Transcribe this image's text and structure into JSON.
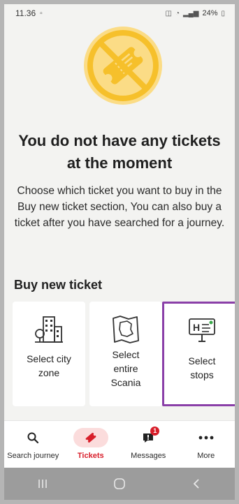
{
  "status_bar": {
    "time": "11.36",
    "battery": "24%"
  },
  "empty_state": {
    "title": "You do not have any tickets at the moment",
    "description": "Choose which ticket you want to buy in the Buy new ticket section, You can also buy a ticket after you have searched for a journey."
  },
  "buy_section": {
    "title": "Buy new ticket",
    "options": [
      {
        "label": "Select city zone",
        "icon": "city-buildings-icon"
      },
      {
        "label": "Select entire Scania",
        "icon": "scania-map-icon"
      },
      {
        "label": "Select stops",
        "icon": "bus-stop-sign-icon",
        "selected": true
      }
    ]
  },
  "bottom_nav": {
    "items": [
      {
        "label": "Search journey",
        "icon": "search-icon"
      },
      {
        "label": "Tickets",
        "icon": "ticket-icon",
        "active": true
      },
      {
        "label": "Messages",
        "icon": "message-icon",
        "badge": "1"
      },
      {
        "label": "More",
        "icon": "more-dots-icon"
      }
    ]
  },
  "colors": {
    "accent": "#d81e2a",
    "hero_yellow": "#f6c02b",
    "selection_border": "#8a3fa8",
    "background": "#f3f3f1"
  }
}
